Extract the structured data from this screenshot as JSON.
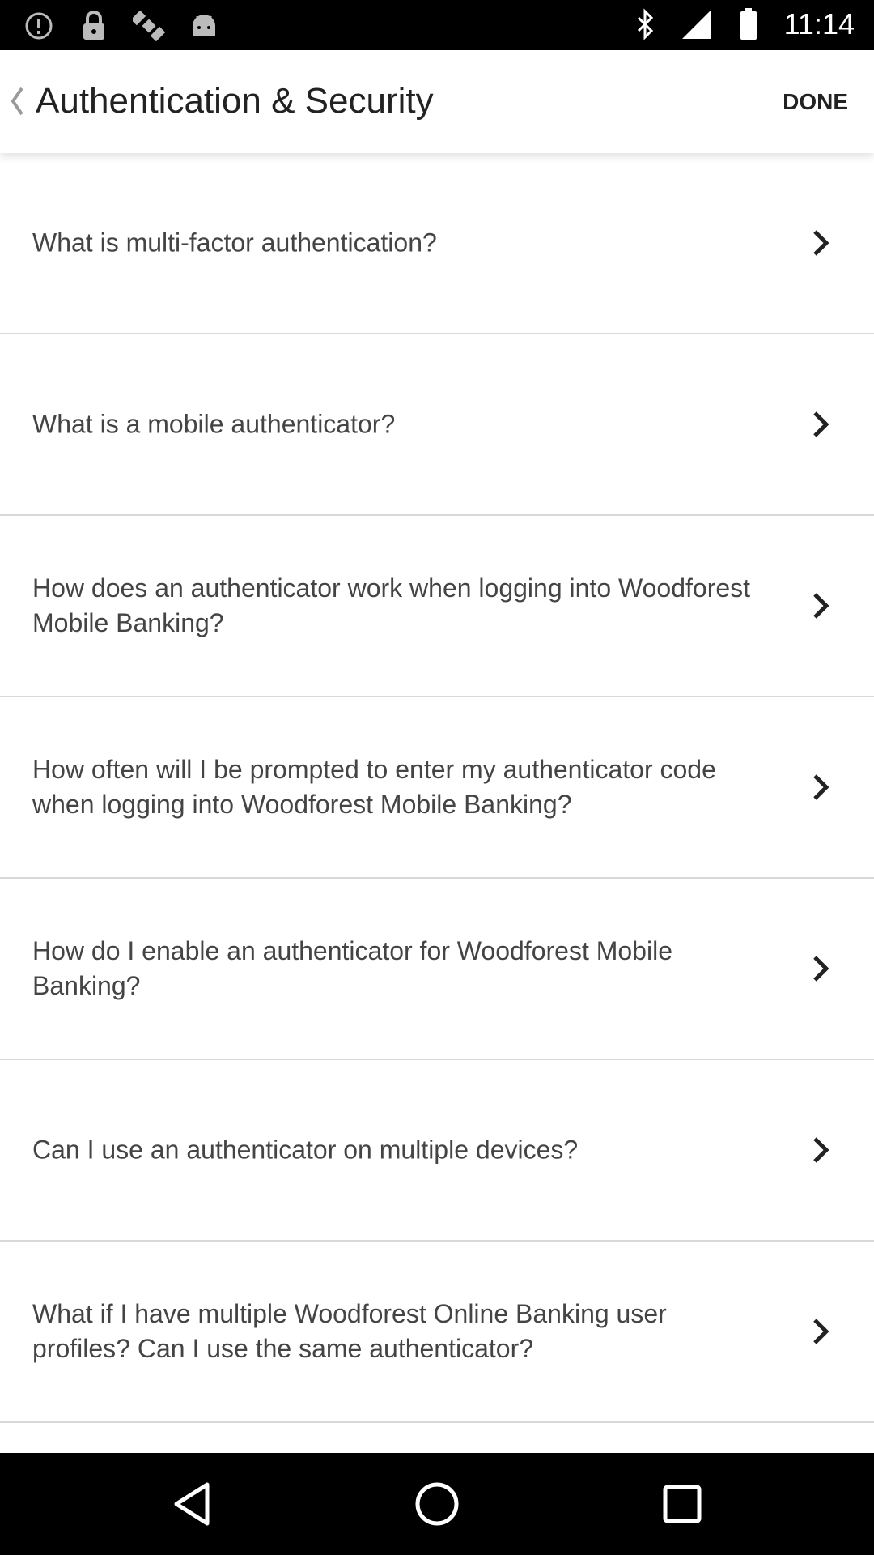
{
  "status_bar": {
    "time": "11:14",
    "left_icons": [
      "alert-circle-icon",
      "lock-icon",
      "satellite-icon",
      "android-icon"
    ],
    "right_icons": [
      "bluetooth-icon",
      "signal-icon",
      "battery-icon"
    ]
  },
  "header": {
    "title": "Authentication & Security",
    "done_label": "DONE"
  },
  "faq": {
    "items": [
      {
        "question": "What is multi-factor authentication?"
      },
      {
        "question": "What is a mobile authenticator?"
      },
      {
        "question": "How does an authenticator work when logging into Woodforest Mobile Banking?"
      },
      {
        "question": "How often will I be prompted to enter my authenticator code when logging into Woodforest Mobile Banking?"
      },
      {
        "question": "How do I enable an authenticator for Woodforest Mobile Banking?"
      },
      {
        "question": "Can I use an authenticator on multiple devices?"
      },
      {
        "question": "What if I have multiple Woodforest Online Banking user profiles? Can I use the same authenticator?"
      }
    ]
  },
  "colors": {
    "status_bar": "#000000",
    "text_primary": "#222222",
    "text_item": "#444444",
    "divider": "#d9d9d9"
  }
}
